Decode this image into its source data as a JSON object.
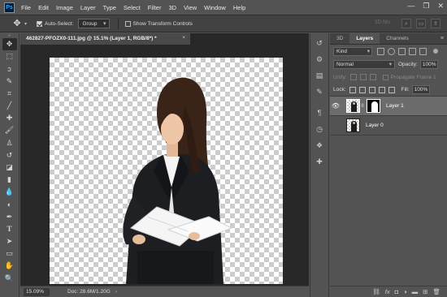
{
  "app": {
    "logo_text": "Ps"
  },
  "menu": [
    "File",
    "Edit",
    "Image",
    "Layer",
    "Type",
    "Select",
    "Filter",
    "3D",
    "View",
    "Window",
    "Help"
  ],
  "window_controls": {
    "minimize": "—",
    "restore": "❐",
    "close": "✕"
  },
  "options": {
    "auto_select_label": "Auto-Select:",
    "auto_select_checked": true,
    "target_value": "Group",
    "transform_label": "Show Transform Controls",
    "transform_checked": false,
    "mode_3d_label": "3D Mo"
  },
  "document": {
    "tab_title": "462827-PFOZX0-111.jpg @ 15.1% (Layer 1, RGB/8*) *",
    "tab_close": "×",
    "zoom": "15.09%",
    "doc_size": "Doc: 28.6M/1.20G",
    "status_caret": "›"
  },
  "tools": [
    "move-tool",
    "marquee-tool",
    "lasso-tool",
    "quick-select-tool",
    "crop-tool",
    "eyedropper-tool",
    "healing-brush-tool",
    "brush-tool",
    "clone-stamp-tool",
    "history-brush-tool",
    "eraser-tool",
    "gradient-tool",
    "blur-tool",
    "dodge-tool",
    "pen-tool",
    "type-tool",
    "path-select-tool",
    "shape-tool",
    "hand-tool",
    "zoom-tool"
  ],
  "layers_panel": {
    "tabs": [
      "3D",
      "Layers",
      "Channels"
    ],
    "active_tab": "Layers",
    "kind_label": "Kind",
    "blend_mode": "Normal",
    "opacity_label": "Opacity:",
    "opacity_value": "100%",
    "unify_label": "Unify:",
    "propagate_label": "Propagate Frame 1",
    "lock_label": "Lock:",
    "fill_label": "Fill:",
    "fill_value": "100%",
    "layers": [
      {
        "name": "Layer 1",
        "selected": true,
        "visible": true,
        "has_mask": true
      },
      {
        "name": "Layer 0",
        "selected": false,
        "visible": false,
        "has_mask": false
      }
    ]
  },
  "colors": {
    "chrome": "#535353",
    "dark": "#282828",
    "accent_blue": "#31a8ff",
    "selected_layer": "#6c6c6c"
  }
}
